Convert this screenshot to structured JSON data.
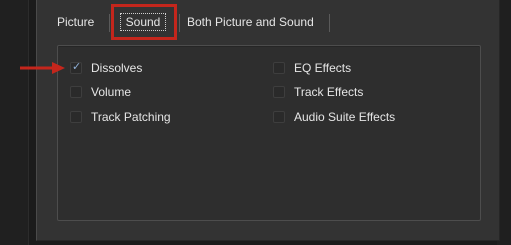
{
  "tabs": [
    {
      "label": "Picture",
      "selected": false
    },
    {
      "label": "Sound",
      "selected": true
    },
    {
      "label": "Both Picture and Sound",
      "selected": false
    }
  ],
  "options": {
    "left_column": [
      {
        "label": "Dissolves",
        "checked": true
      },
      {
        "label": "Volume",
        "checked": false
      },
      {
        "label": "Track Patching",
        "checked": false
      }
    ],
    "right_column": [
      {
        "label": "EQ Effects",
        "checked": false
      },
      {
        "label": "Track Effects",
        "checked": false
      },
      {
        "label": "Audio Suite Effects",
        "checked": false
      }
    ]
  },
  "annotations": {
    "highlight_color": "#c4261c",
    "arrow_color": "#c4261c",
    "arrow_target": "Dissolves"
  },
  "icons": {
    "check_mark": "✓"
  }
}
